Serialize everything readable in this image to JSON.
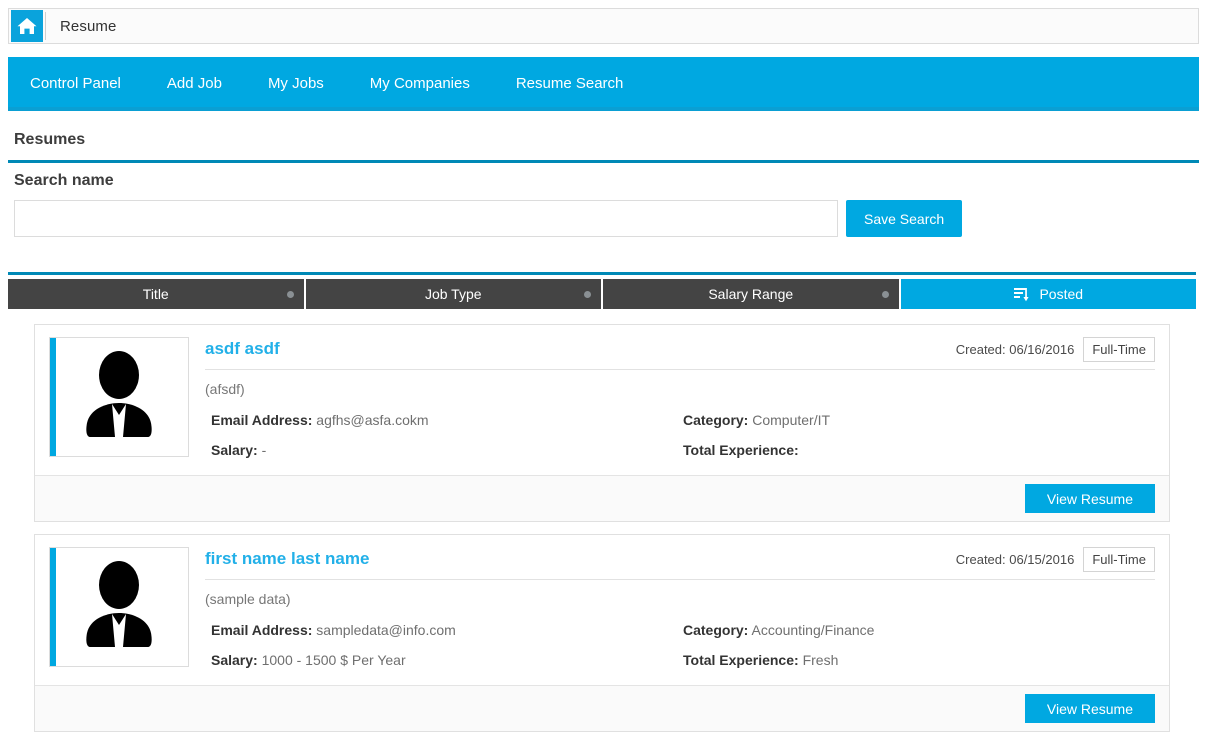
{
  "breadcrumb": {
    "home_icon": "home-icon",
    "label": "Resume"
  },
  "nav": {
    "items": [
      {
        "label": "Control Panel"
      },
      {
        "label": "Add Job"
      },
      {
        "label": "My Jobs"
      },
      {
        "label": "My Companies"
      },
      {
        "label": "Resume Search"
      }
    ]
  },
  "page": {
    "title": "Resumes"
  },
  "search": {
    "label": "Search name",
    "value": "",
    "placeholder": "",
    "save_button": "Save Search"
  },
  "sort_header": {
    "columns": [
      {
        "label": "Title",
        "active": false,
        "indicator": "dot"
      },
      {
        "label": "Job Type",
        "active": false,
        "indicator": "dot"
      },
      {
        "label": "Salary Range",
        "active": false,
        "indicator": "dot"
      },
      {
        "label": "Posted",
        "active": true,
        "indicator": "sort-descending-icon"
      }
    ]
  },
  "labels": {
    "email": "Email Address:",
    "salary": "Salary:",
    "category": "Category:",
    "total_experience": "Total Experience:",
    "created_prefix": "Created:",
    "view_resume": "View Resume"
  },
  "resumes": [
    {
      "name": "asdf asdf",
      "subtitle": "(afsdf)",
      "created": "Created: 06/16/2016",
      "job_type": "Full-Time",
      "email": "agfhs@asfa.cokm",
      "salary": "-",
      "category": "Computer/IT",
      "total_experience": "",
      "view_button": "View Resume",
      "avatar_icon": "person-avatar-icon"
    },
    {
      "name": "first name  last name",
      "subtitle": "(sample data)",
      "created": "Created: 06/15/2016",
      "job_type": "Full-Time",
      "email": "sampledata@info.com",
      "salary": "1000 - 1500 $ Per Year",
      "category": "Accounting/Finance",
      "total_experience": "Fresh",
      "view_button": "View Resume",
      "avatar_icon": "person-avatar-icon"
    }
  ],
  "colors": {
    "accent": "#00a8e1",
    "accent_dark": "#0089b6",
    "header_dark": "#444444",
    "link": "#22b0e8"
  }
}
